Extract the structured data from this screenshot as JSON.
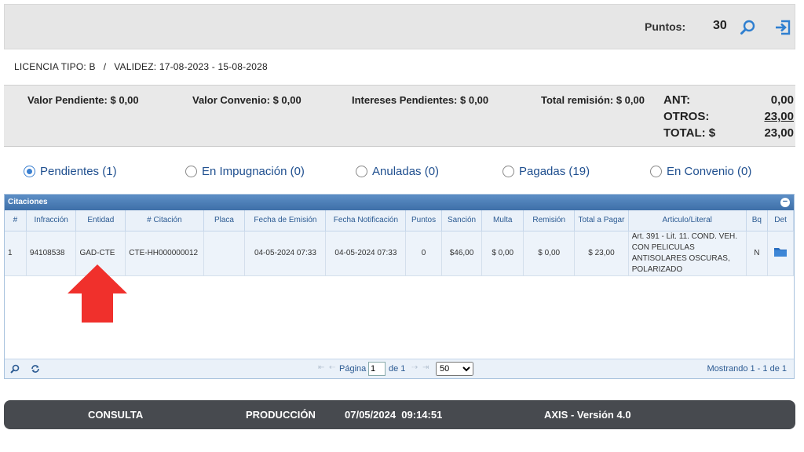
{
  "header": {
    "puntos_label": "Puntos:",
    "puntos_value": "30"
  },
  "license": {
    "tipo": "LICENCIA TIPO: B",
    "separator": "/",
    "validez": "VALIDEZ: 17-08-2023 - 15-08-2028"
  },
  "summary": {
    "valor_pendiente": "Valor Pendiente: $  0,00",
    "valor_convenio": "Valor Convenio: $  0,00",
    "intereses_pendientes": "Intereses Pendientes: $  0,00",
    "total_remision": "Total remisión: $  0,00",
    "ant_label": "ANT:",
    "ant_value": "0,00",
    "otros_label": "OTROS:",
    "otros_value": "23,00",
    "total_label": "TOTAL: $",
    "total_value": "23,00"
  },
  "filters": {
    "pendientes": "Pendientes (1)",
    "impugnacion": "En Impugnación (0)",
    "anuladas": "Anuladas (0)",
    "pagadas": "Pagadas (19)",
    "convenio": "En Convenio (0)"
  },
  "grid": {
    "caption": "Citaciones",
    "columns": [
      "#",
      "Infracción",
      "Entidad",
      "# Citación",
      "Placa",
      "Fecha de Emisión",
      "Fecha Notificación",
      "Puntos",
      "Sanción",
      "Multa",
      "Remisión",
      "Total a Pagar",
      "Articulo/Literal",
      "Bq",
      "Det"
    ],
    "rows": [
      {
        "num": "1",
        "infraccion": "94108538",
        "entidad": "GAD-CTE",
        "citacion": "CTE-HH000000012",
        "placa": "",
        "emision": "04-05-2024 07:33",
        "notificacion": "04-05-2024 07:33",
        "puntos": "0",
        "sancion": "$46,00",
        "multa": "$ 0,00",
        "remision": "$ 0,00",
        "total": "$ 23,00",
        "articulo": "Art. 391 - Lit. 11. COND. VEH. CON PELICULAS ANTISOLARES OSCURAS, POLARIZADO",
        "bq": "N"
      }
    ]
  },
  "pager": {
    "pagina_label": "Página",
    "page_value": "1",
    "of_label": "de 1",
    "page_size": "50",
    "records": "Mostrando 1 - 1 de 1"
  },
  "footer": {
    "consulta": "CONSULTA",
    "produccion": "PRODUCCIÓN",
    "datetime": "07/05/2024  09:14:51",
    "version": "AXIS - Versión 4.0"
  },
  "colors": {
    "accent": "#3a7fd0",
    "caption_bar": "#3e6fa8",
    "footer_bg": "#474a4f",
    "arrow": "#f0302c"
  }
}
